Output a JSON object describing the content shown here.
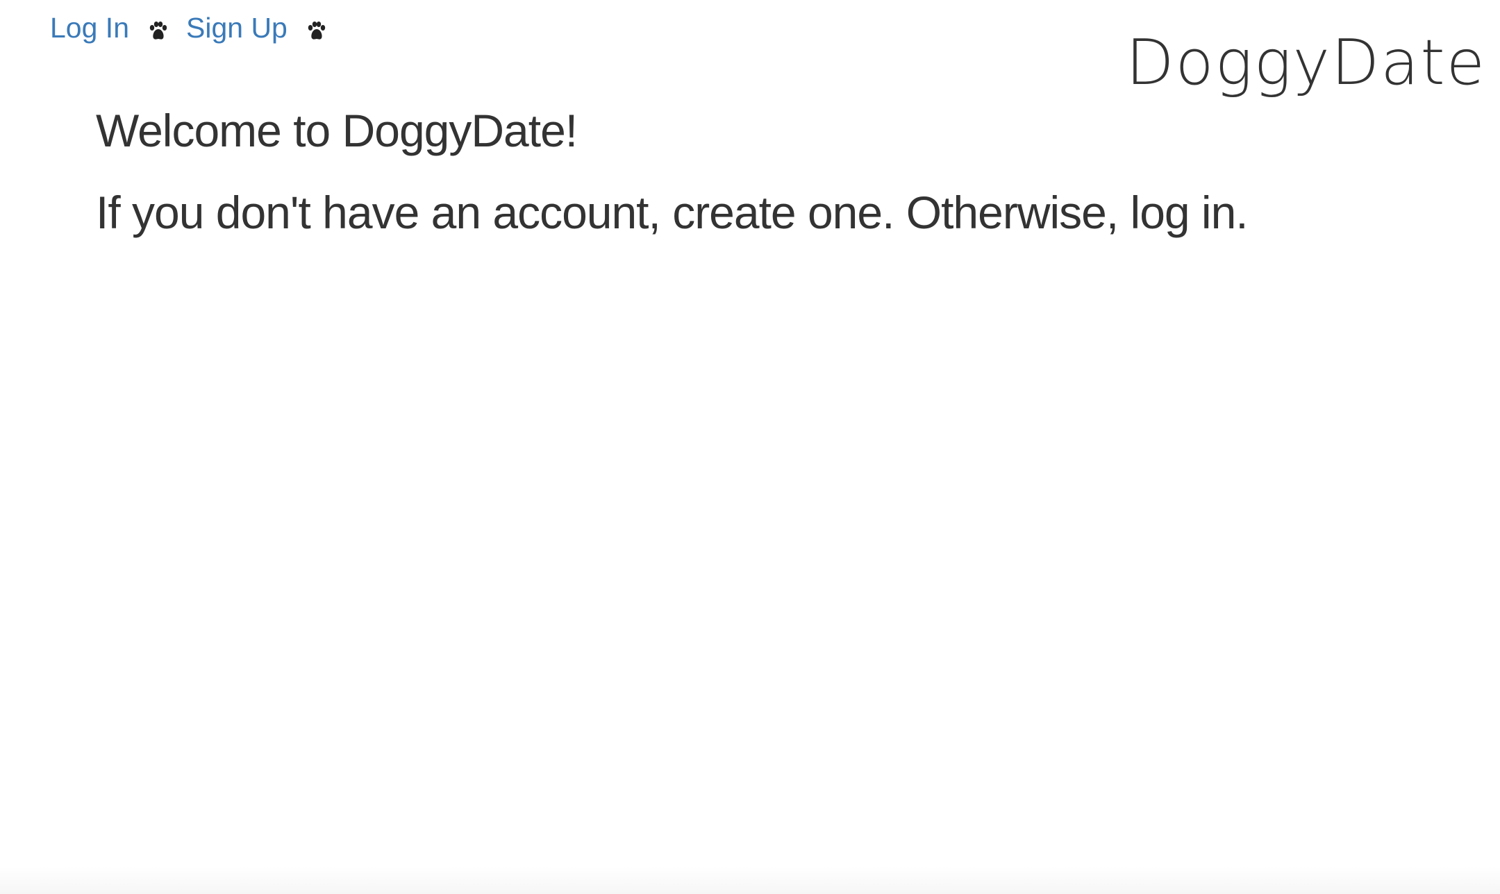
{
  "nav": {
    "login_label": "Log In",
    "signup_label": "Sign Up",
    "separator_icon": "paw-icon",
    "link_color": "#3a7ab9"
  },
  "brand": {
    "name": "DoggyDate"
  },
  "main": {
    "heading": "Welcome to DoggyDate!",
    "instruction": "If you don't have an account, create one. Otherwise, log in."
  },
  "colors": {
    "text": "#333333",
    "background": "#ffffff"
  }
}
